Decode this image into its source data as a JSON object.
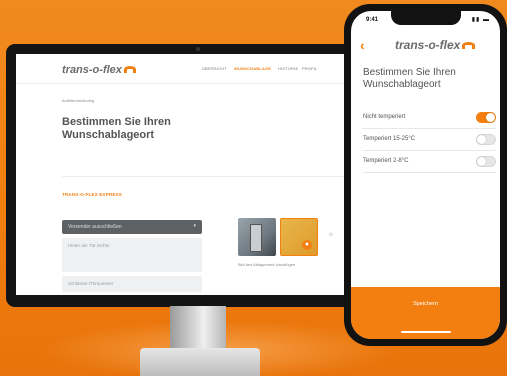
{
  "brand": {
    "logo_text": "trans-o-flex",
    "accent_color": "#f27f10"
  },
  "desktop": {
    "nav": [
      "ÜBERSICHT",
      "WUNSCHABLAGE",
      "HISTORIE",
      "PROFIL"
    ],
    "nav_active_index": 1,
    "breadcrumb": "Anliefermonitoring",
    "title": "Bestimmen Sie Ihren Wunschablageort",
    "section_label": "TRANS-O-FLEX EXPRESS",
    "select_value": "Versender ausschließen",
    "textarea_placeholder": "Hinter der Tür rechts",
    "input_placeholder": "Schlüssel-/Türnummer",
    "photo_caption": "Bild des Ablageortes hinzufügen",
    "photo_add_glyph": "+"
  },
  "phone": {
    "status_time": "9:41",
    "back_glyph": "‹",
    "title": "Bestimmen Sie Ihren Wunschablageort",
    "options": [
      {
        "label": "Nicht temperiert",
        "on": true
      },
      {
        "label": "Temperiert 15-25°C",
        "on": false
      },
      {
        "label": "Temperiert 2-8°C",
        "on": false
      }
    ],
    "save_label": "Speichern"
  }
}
